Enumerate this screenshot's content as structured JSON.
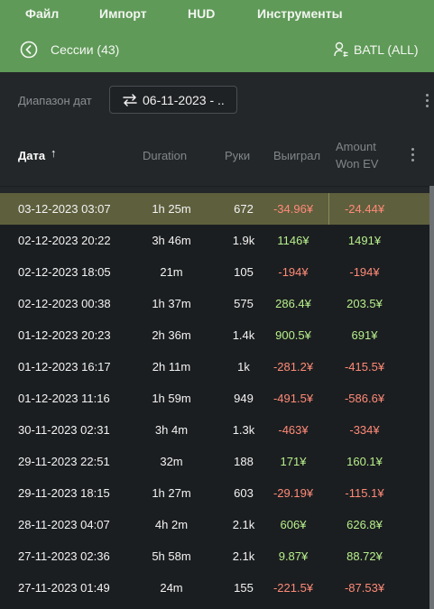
{
  "menu": {
    "items": [
      "Файл",
      "Импорт",
      "HUD",
      "Инструменты"
    ]
  },
  "header": {
    "sessions_title": "Сессии (43)",
    "player": "BATL (ALL)"
  },
  "toolbar": {
    "date_range_label": "Диапазон дат",
    "date_range_value": "06-11-2023 - .."
  },
  "columns": {
    "date": "Дата",
    "sort_indicator": "↑",
    "duration": "Duration",
    "hands": "Руки",
    "won": "Выиграл",
    "amount_won_ev_line1": "Amount",
    "amount_won_ev_line2": "Won EV"
  },
  "rows": [
    {
      "date": "03-12-2023 03:07",
      "duration": "1h 25m",
      "hands": "672",
      "won": "-34.96¥",
      "won_ev": "-24.44¥"
    },
    {
      "date": "02-12-2023 20:22",
      "duration": "3h 46m",
      "hands": "1.9k",
      "won": "1146¥",
      "won_ev": "1491¥"
    },
    {
      "date": "02-12-2023 18:05",
      "duration": "21m",
      "hands": "105",
      "won": "-194¥",
      "won_ev": "-194¥"
    },
    {
      "date": "02-12-2023 00:38",
      "duration": "1h 37m",
      "hands": "575",
      "won": "286.4¥",
      "won_ev": "203.5¥"
    },
    {
      "date": "01-12-2023 20:23",
      "duration": "2h 36m",
      "hands": "1.4k",
      "won": "900.5¥",
      "won_ev": "691¥"
    },
    {
      "date": "01-12-2023 16:17",
      "duration": "2h 11m",
      "hands": "1k",
      "won": "-281.2¥",
      "won_ev": "-415.5¥"
    },
    {
      "date": "01-12-2023 11:16",
      "duration": "1h 59m",
      "hands": "949",
      "won": "-491.5¥",
      "won_ev": "-586.6¥"
    },
    {
      "date": "30-11-2023 02:31",
      "duration": "3h 4m",
      "hands": "1.3k",
      "won": "-463¥",
      "won_ev": "-334¥"
    },
    {
      "date": "29-11-2023 22:51",
      "duration": "32m",
      "hands": "188",
      "won": "171¥",
      "won_ev": "160.1¥"
    },
    {
      "date": "29-11-2023 18:15",
      "duration": "1h 27m",
      "hands": "603",
      "won": "-29.19¥",
      "won_ev": "-115.1¥"
    },
    {
      "date": "28-11-2023 04:07",
      "duration": "4h 2m",
      "hands": "2.1k",
      "won": "606¥",
      "won_ev": "626.8¥"
    },
    {
      "date": "27-11-2023 02:36",
      "duration": "5h 58m",
      "hands": "2.1k",
      "won": "9.87¥",
      "won_ev": "88.72¥"
    },
    {
      "date": "27-11-2023 01:49",
      "duration": "24m",
      "hands": "155",
      "won": "-221.5¥",
      "won_ev": "-87.53¥"
    }
  ],
  "selected_row_index": 0,
  "colors": {
    "accent_green": "#5f9a58",
    "positive": "#b7ef8c",
    "negative": "#ff8a78",
    "selected_row": "#5e5f3d"
  },
  "icons": [
    "back-arrow-circle-icon",
    "user-settings-icon",
    "swap-arrows-icon",
    "more-vertical-icon"
  ]
}
